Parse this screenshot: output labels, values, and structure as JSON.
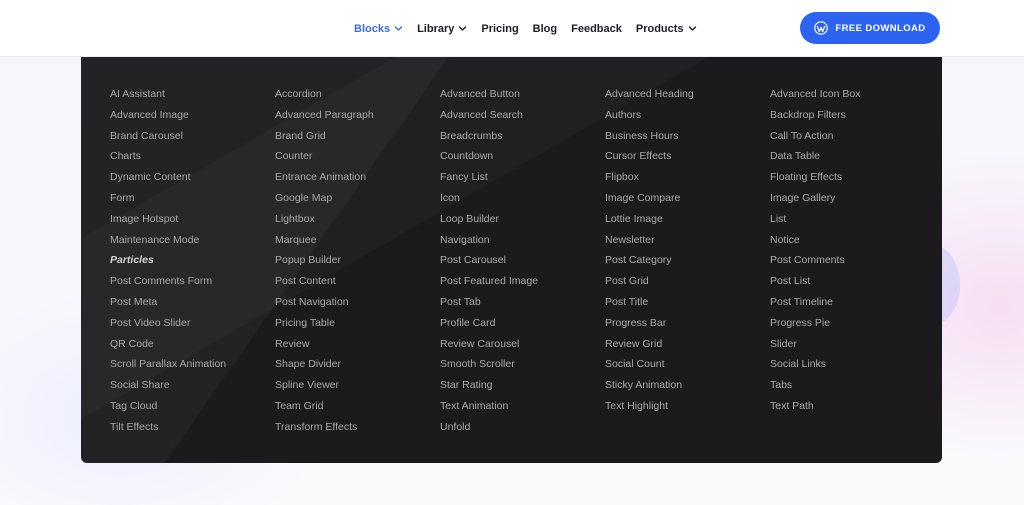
{
  "nav": {
    "items": [
      {
        "label": "Blocks",
        "dropdown": true,
        "active": true
      },
      {
        "label": "Library",
        "dropdown": true,
        "active": false
      },
      {
        "label": "Pricing",
        "dropdown": false,
        "active": false
      },
      {
        "label": "Blog",
        "dropdown": false,
        "active": false
      },
      {
        "label": "Feedback",
        "dropdown": false,
        "active": false
      },
      {
        "label": "Products",
        "dropdown": true,
        "active": false
      }
    ],
    "cta_label": "FREE DOWNLOAD",
    "cta_icon": "wordpress-icon"
  },
  "colors": {
    "accent": "#2c63f0",
    "active_nav": "#3b6ae8",
    "menu_bg": "#1b1b1d",
    "menu_text": "#a9a9ad"
  },
  "blocks_menu": {
    "columns": [
      [
        "AI Assistant",
        "Advanced Image",
        "Brand Carousel",
        "Charts",
        "Dynamic Content",
        "Form",
        "Image Hotspot",
        "Maintenance Mode",
        "Particles",
        "Post Comments Form",
        "Post Meta",
        "Post Video Slider",
        "QR Code",
        "Scroll Parallax Animation",
        "Social Share",
        "Tag Cloud",
        "Tilt Effects"
      ],
      [
        "Accordion",
        "Advanced Paragraph",
        "Brand Grid",
        "Counter",
        "Entrance Animation",
        "Google Map",
        "Lightbox",
        "Marquee",
        "Popup Builder",
        "Post Content",
        "Post Navigation",
        "Pricing Table",
        "Review",
        "Shape Divider",
        "Spline Viewer",
        "Team Grid",
        "Transform Effects"
      ],
      [
        "Advanced Button",
        "Advanced Search",
        "Breadcrumbs",
        "Countdown",
        "Fancy List",
        "Icon",
        "Loop Builder",
        "Navigation",
        "Post Carousel",
        "Post Featured Image",
        "Post Tab",
        "Profile Card",
        "Review Carousel",
        "Smooth Scroller",
        "Star Rating",
        "Text Animation",
        "Unfold"
      ],
      [
        "Advanced Heading",
        "Authors",
        "Business Hours",
        "Cursor Effects",
        "Flipbox",
        "Image Compare",
        "Lottie Image",
        "Newsletter",
        "Post Category",
        "Post Grid",
        "Post Title",
        "Progress Bar",
        "Review Grid",
        "Social Count",
        "Sticky Animation",
        "Text Highlight"
      ],
      [
        "Advanced Icon Box",
        "Backdrop Filters",
        "Call To Action",
        "Data Table",
        "Floating Effects",
        "Image Gallery",
        "List",
        "Notice",
        "Post Comments",
        "Post List",
        "Post Timeline",
        "Progress Pie",
        "Slider",
        "Social Links",
        "Tabs",
        "Text Path"
      ]
    ],
    "highlighted": "Particles"
  }
}
